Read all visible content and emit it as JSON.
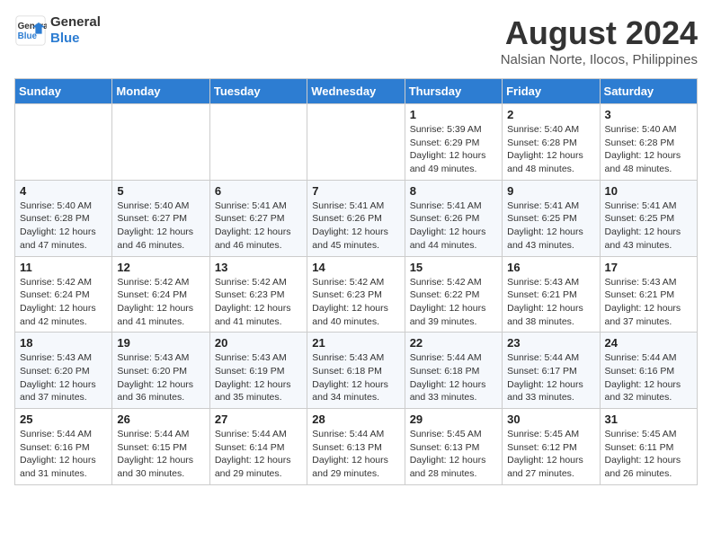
{
  "header": {
    "logo_line1": "General",
    "logo_line2": "Blue",
    "month": "August 2024",
    "location": "Nalsian Norte, Ilocos, Philippines"
  },
  "weekdays": [
    "Sunday",
    "Monday",
    "Tuesday",
    "Wednesday",
    "Thursday",
    "Friday",
    "Saturday"
  ],
  "weeks": [
    [
      {
        "day": "",
        "info": ""
      },
      {
        "day": "",
        "info": ""
      },
      {
        "day": "",
        "info": ""
      },
      {
        "day": "",
        "info": ""
      },
      {
        "day": "1",
        "info": "Sunrise: 5:39 AM\nSunset: 6:29 PM\nDaylight: 12 hours\nand 49 minutes."
      },
      {
        "day": "2",
        "info": "Sunrise: 5:40 AM\nSunset: 6:28 PM\nDaylight: 12 hours\nand 48 minutes."
      },
      {
        "day": "3",
        "info": "Sunrise: 5:40 AM\nSunset: 6:28 PM\nDaylight: 12 hours\nand 48 minutes."
      }
    ],
    [
      {
        "day": "4",
        "info": "Sunrise: 5:40 AM\nSunset: 6:28 PM\nDaylight: 12 hours\nand 47 minutes."
      },
      {
        "day": "5",
        "info": "Sunrise: 5:40 AM\nSunset: 6:27 PM\nDaylight: 12 hours\nand 46 minutes."
      },
      {
        "day": "6",
        "info": "Sunrise: 5:41 AM\nSunset: 6:27 PM\nDaylight: 12 hours\nand 46 minutes."
      },
      {
        "day": "7",
        "info": "Sunrise: 5:41 AM\nSunset: 6:26 PM\nDaylight: 12 hours\nand 45 minutes."
      },
      {
        "day": "8",
        "info": "Sunrise: 5:41 AM\nSunset: 6:26 PM\nDaylight: 12 hours\nand 44 minutes."
      },
      {
        "day": "9",
        "info": "Sunrise: 5:41 AM\nSunset: 6:25 PM\nDaylight: 12 hours\nand 43 minutes."
      },
      {
        "day": "10",
        "info": "Sunrise: 5:41 AM\nSunset: 6:25 PM\nDaylight: 12 hours\nand 43 minutes."
      }
    ],
    [
      {
        "day": "11",
        "info": "Sunrise: 5:42 AM\nSunset: 6:24 PM\nDaylight: 12 hours\nand 42 minutes."
      },
      {
        "day": "12",
        "info": "Sunrise: 5:42 AM\nSunset: 6:24 PM\nDaylight: 12 hours\nand 41 minutes."
      },
      {
        "day": "13",
        "info": "Sunrise: 5:42 AM\nSunset: 6:23 PM\nDaylight: 12 hours\nand 41 minutes."
      },
      {
        "day": "14",
        "info": "Sunrise: 5:42 AM\nSunset: 6:23 PM\nDaylight: 12 hours\nand 40 minutes."
      },
      {
        "day": "15",
        "info": "Sunrise: 5:42 AM\nSunset: 6:22 PM\nDaylight: 12 hours\nand 39 minutes."
      },
      {
        "day": "16",
        "info": "Sunrise: 5:43 AM\nSunset: 6:21 PM\nDaylight: 12 hours\nand 38 minutes."
      },
      {
        "day": "17",
        "info": "Sunrise: 5:43 AM\nSunset: 6:21 PM\nDaylight: 12 hours\nand 37 minutes."
      }
    ],
    [
      {
        "day": "18",
        "info": "Sunrise: 5:43 AM\nSunset: 6:20 PM\nDaylight: 12 hours\nand 37 minutes."
      },
      {
        "day": "19",
        "info": "Sunrise: 5:43 AM\nSunset: 6:20 PM\nDaylight: 12 hours\nand 36 minutes."
      },
      {
        "day": "20",
        "info": "Sunrise: 5:43 AM\nSunset: 6:19 PM\nDaylight: 12 hours\nand 35 minutes."
      },
      {
        "day": "21",
        "info": "Sunrise: 5:43 AM\nSunset: 6:18 PM\nDaylight: 12 hours\nand 34 minutes."
      },
      {
        "day": "22",
        "info": "Sunrise: 5:44 AM\nSunset: 6:18 PM\nDaylight: 12 hours\nand 33 minutes."
      },
      {
        "day": "23",
        "info": "Sunrise: 5:44 AM\nSunset: 6:17 PM\nDaylight: 12 hours\nand 33 minutes."
      },
      {
        "day": "24",
        "info": "Sunrise: 5:44 AM\nSunset: 6:16 PM\nDaylight: 12 hours\nand 32 minutes."
      }
    ],
    [
      {
        "day": "25",
        "info": "Sunrise: 5:44 AM\nSunset: 6:16 PM\nDaylight: 12 hours\nand 31 minutes."
      },
      {
        "day": "26",
        "info": "Sunrise: 5:44 AM\nSunset: 6:15 PM\nDaylight: 12 hours\nand 30 minutes."
      },
      {
        "day": "27",
        "info": "Sunrise: 5:44 AM\nSunset: 6:14 PM\nDaylight: 12 hours\nand 29 minutes."
      },
      {
        "day": "28",
        "info": "Sunrise: 5:44 AM\nSunset: 6:13 PM\nDaylight: 12 hours\nand 29 minutes."
      },
      {
        "day": "29",
        "info": "Sunrise: 5:45 AM\nSunset: 6:13 PM\nDaylight: 12 hours\nand 28 minutes."
      },
      {
        "day": "30",
        "info": "Sunrise: 5:45 AM\nSunset: 6:12 PM\nDaylight: 12 hours\nand 27 minutes."
      },
      {
        "day": "31",
        "info": "Sunrise: 5:45 AM\nSunset: 6:11 PM\nDaylight: 12 hours\nand 26 minutes."
      }
    ]
  ]
}
